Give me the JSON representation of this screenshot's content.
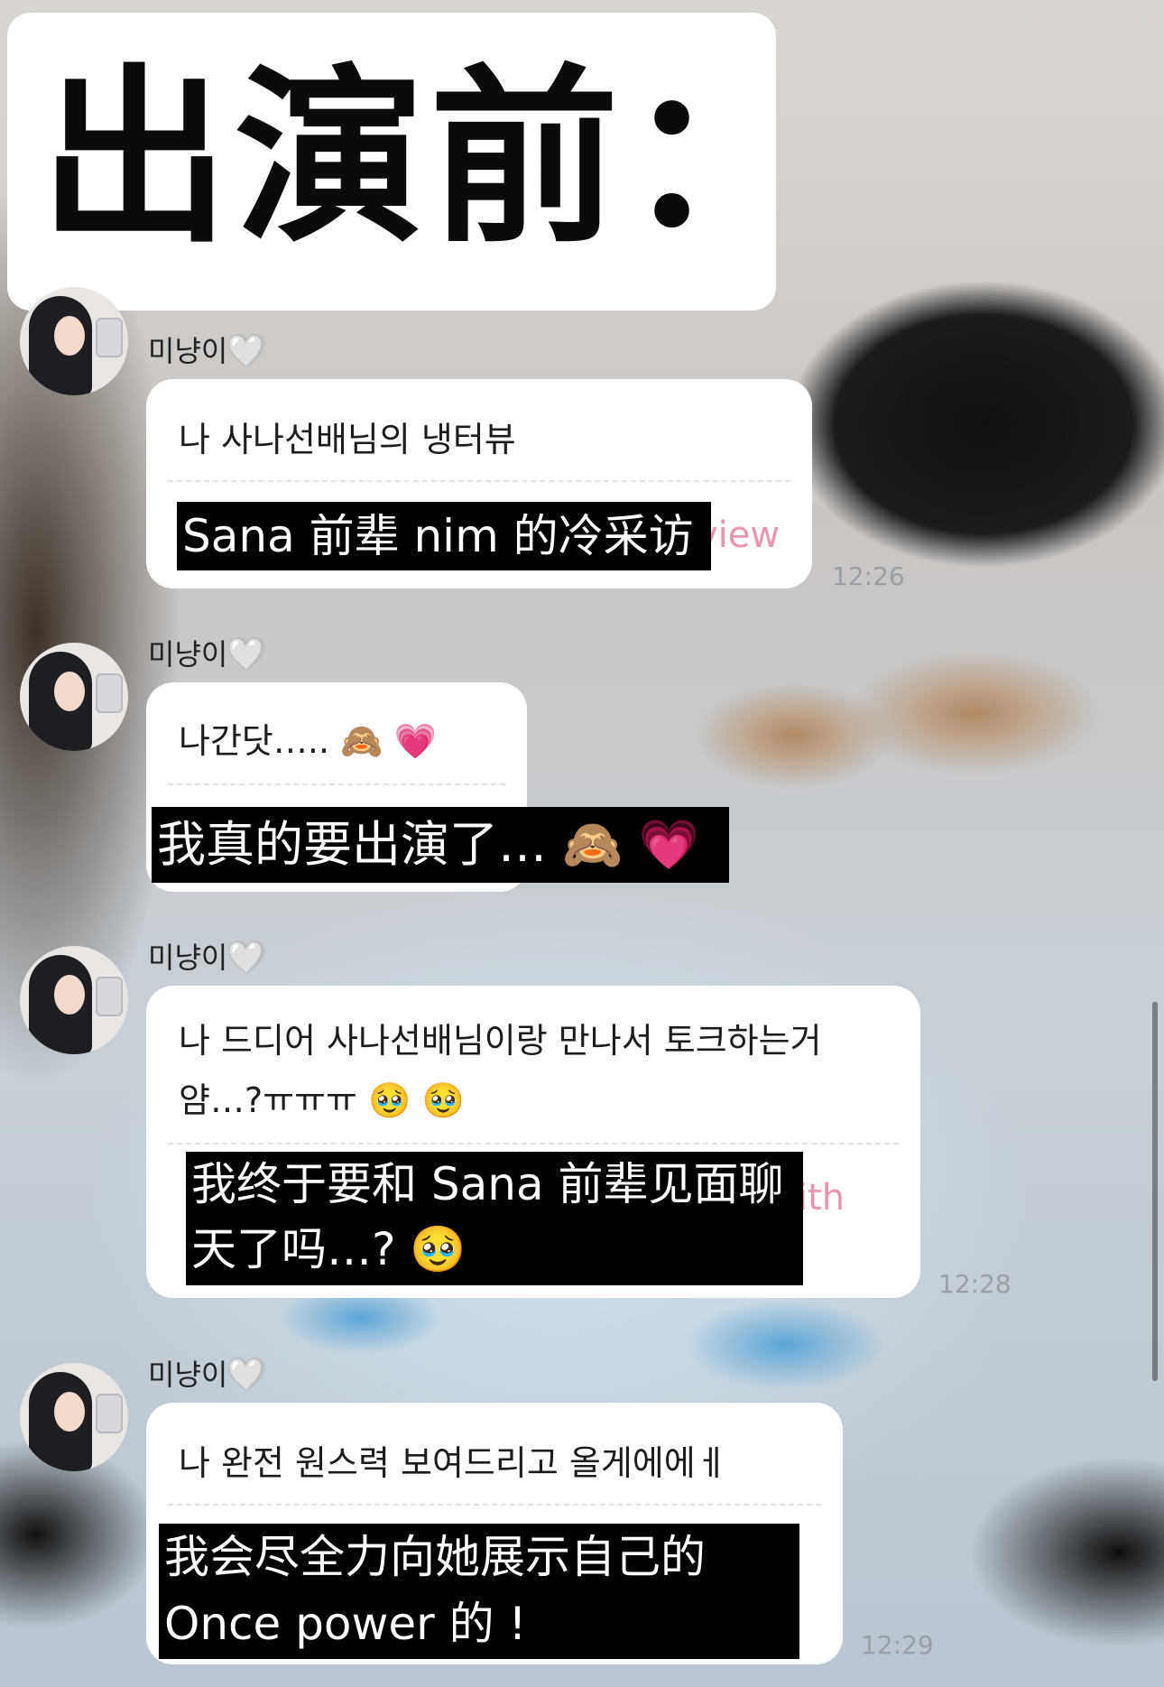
{
  "title_card": {
    "text": "出演前："
  },
  "messages": [
    {
      "sender": "미냥이",
      "heart": "🤍",
      "korean": "나 사나선배님의 냉터뷰",
      "english_tail": "view",
      "subtitle": "Sana 前辈 nim 的冷采访",
      "time": "12:26"
    },
    {
      "sender": "미냥이",
      "heart": "🤍",
      "korean": "나간닷….. 🙈 💗",
      "subtitle": "我真的要出演了… 🙈 💗"
    },
    {
      "sender": "미냥이",
      "heart": "🤍",
      "korean_line1": "나 드디어 사나선배님이랑 만나서 토크하는거",
      "korean_line2": "얌…?ㅠㅠㅠ 🥹 🥹",
      "english_tail": "ith",
      "subtitle_line1": "我终于要和 Sana 前辈见面聊",
      "subtitle_line2": "天了吗…?  🥹",
      "time": "12:28"
    },
    {
      "sender": "미냥이",
      "heart": "🤍",
      "korean": "나 완전 원스력 보여드리고 올게에에ㅔ",
      "subtitle_line1": "我会尽全力向她展示自己的",
      "subtitle_line2": "Once power 的 !",
      "time": "12:29"
    }
  ]
}
